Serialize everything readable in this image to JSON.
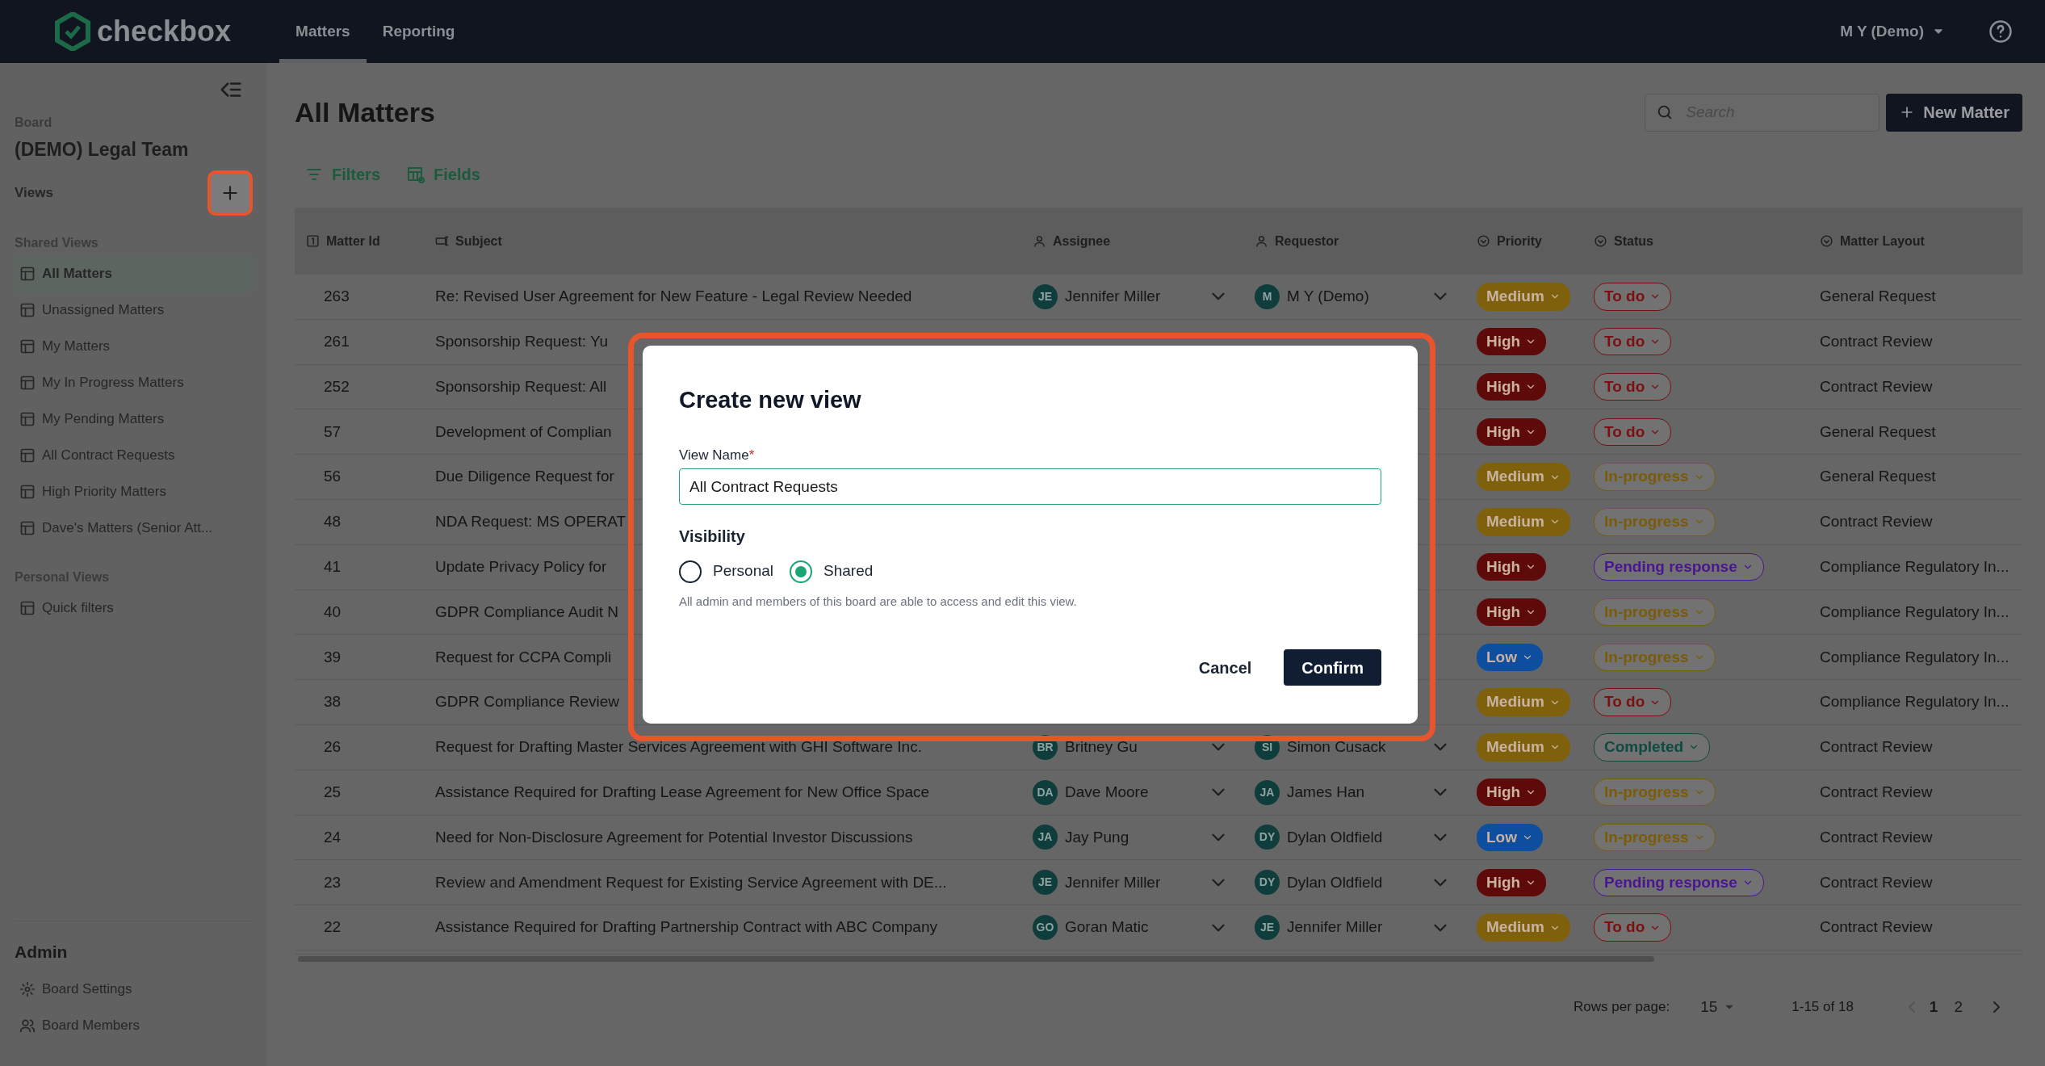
{
  "navbar": {
    "logo": "checkbox",
    "tabs": [
      {
        "label": "Matters",
        "selected": true
      },
      {
        "label": "Reporting",
        "selected": false
      }
    ],
    "user": "M Y (Demo)"
  },
  "sidebar": {
    "board_label": "Board",
    "board_name": "(DEMO) Legal Team",
    "views_label": "Views",
    "sections": [
      {
        "title": "Shared Views",
        "items": [
          {
            "label": "All Matters",
            "selected": true
          },
          {
            "label": "Unassigned Matters",
            "selected": false
          },
          {
            "label": "My Matters",
            "selected": false
          },
          {
            "label": "My In Progress Matters",
            "selected": false
          },
          {
            "label": "My Pending Matters",
            "selected": false
          },
          {
            "label": "All Contract Requests",
            "selected": false
          },
          {
            "label": "High Priority Matters",
            "selected": false
          },
          {
            "label": "Dave's Matters (Senior Att...",
            "selected": false
          }
        ]
      },
      {
        "title": "Personal Views",
        "items": [
          {
            "label": "Quick filters",
            "selected": false
          }
        ]
      }
    ],
    "admin": {
      "title": "Admin",
      "items": [
        {
          "label": "Board Settings",
          "kind": "settings"
        },
        {
          "label": "Board Members",
          "kind": "members"
        }
      ]
    }
  },
  "page": {
    "title": "All Matters",
    "search": {
      "placeholder": "Search"
    },
    "new_button": "New Matter",
    "toolbar": [
      {
        "label": "Filters",
        "kind": "filter"
      },
      {
        "label": "Fields",
        "kind": "fields"
      }
    ]
  },
  "table": {
    "columns": [
      {
        "label": "Matter Id",
        "kind": "number"
      },
      {
        "label": "Subject",
        "kind": "text"
      },
      {
        "label": "Assignee",
        "kind": "person"
      },
      {
        "label": "Requestor",
        "kind": "person"
      },
      {
        "label": "Priority",
        "kind": "select"
      },
      {
        "label": "Status",
        "kind": "select"
      },
      {
        "label": "Matter Layout",
        "kind": "select"
      }
    ],
    "rows": [
      {
        "id": "263",
        "subject": "Re: Revised User Agreement for New Feature - Legal Review Needed",
        "assignee": {
          "initials": "JE",
          "name": "Jennifer Miller"
        },
        "requestor": {
          "initials": "M",
          "name": "M Y (Demo)"
        },
        "priority": {
          "label": "Medium",
          "color": "#7f600c"
        },
        "status": {
          "label": "To do",
          "color": "#7a1010"
        },
        "layout": "General Request"
      },
      {
        "id": "261",
        "subject": "Sponsorship Request: Yu",
        "priority": {
          "label": "High",
          "color": "#5e0a0a"
        },
        "status": {
          "label": "To do",
          "color": "#7a1010"
        },
        "layout": "Contract Review"
      },
      {
        "id": "252",
        "subject": "Sponsorship Request: All",
        "priority": {
          "label": "High",
          "color": "#5e0a0a"
        },
        "status": {
          "label": "To do",
          "color": "#7a1010"
        },
        "layout": "Contract Review"
      },
      {
        "id": "57",
        "subject": "Development of Complian",
        "priority": {
          "label": "High",
          "color": "#5e0a0a"
        },
        "status": {
          "label": "To do",
          "color": "#7a1010"
        },
        "layout": "General Request"
      },
      {
        "id": "56",
        "subject": "Due Diligence Request for",
        "priority": {
          "label": "Medium",
          "color": "#7f600c"
        },
        "status": {
          "label": "In-progress",
          "color": "#7a5c08"
        },
        "layout": "General Request"
      },
      {
        "id": "48",
        "subject": "NDA Request: MS OPERAT",
        "priority": {
          "label": "Medium",
          "color": "#7f600c"
        },
        "status": {
          "label": "In-progress",
          "color": "#7a5c08"
        },
        "layout": "Contract Review"
      },
      {
        "id": "41",
        "subject": "Update Privacy Policy for",
        "priority": {
          "label": "High",
          "color": "#5e0a0a"
        },
        "status": {
          "label": "Pending response",
          "color": "#4a1590"
        },
        "layout": "Compliance Regulatory In..."
      },
      {
        "id": "40",
        "subject": "GDPR Compliance Audit N",
        "priority": {
          "label": "High",
          "color": "#5e0a0a"
        },
        "status": {
          "label": "In-progress",
          "color": "#7a5c08"
        },
        "layout": "Compliance Regulatory In..."
      },
      {
        "id": "39",
        "subject": "Request for CCPA Compli",
        "priority": {
          "label": "Low",
          "color": "#0d4e9e"
        },
        "status": {
          "label": "In-progress",
          "color": "#7a5c08"
        },
        "layout": "Compliance Regulatory In..."
      },
      {
        "id": "38",
        "subject": "GDPR Compliance Review",
        "priority": {
          "label": "Medium",
          "color": "#7f600c"
        },
        "status": {
          "label": "To do",
          "color": "#7a1010"
        },
        "layout": "Compliance Regulatory In..."
      },
      {
        "id": "26",
        "subject": "Request for Drafting Master Services Agreement with GHI Software Inc.",
        "assignee": {
          "initials": "BR",
          "name": "Britney Gu"
        },
        "requestor": {
          "initials": "SI",
          "name": "Simon Cusack"
        },
        "priority": {
          "label": "Medium",
          "color": "#7f600c"
        },
        "status": {
          "label": "Completed",
          "color": "#0f4a40"
        },
        "layout": "Contract Review"
      },
      {
        "id": "25",
        "subject": "Assistance Required for Drafting Lease Agreement for New Office Space",
        "assignee": {
          "initials": "DA",
          "name": "Dave Moore"
        },
        "requestor": {
          "initials": "JA",
          "name": "James Han"
        },
        "priority": {
          "label": "High",
          "color": "#5e0a0a"
        },
        "status": {
          "label": "In-progress",
          "color": "#7a5c08"
        },
        "layout": "Contract Review"
      },
      {
        "id": "24",
        "subject": "Need for Non-Disclosure Agreement for Potential Investor Discussions",
        "assignee": {
          "initials": "JA",
          "name": "Jay Pung"
        },
        "requestor": {
          "initials": "DY",
          "name": "Dylan Oldfield"
        },
        "priority": {
          "label": "Low",
          "color": "#0d4e9e"
        },
        "status": {
          "label": "In-progress",
          "color": "#7a5c08"
        },
        "layout": "Contract Review"
      },
      {
        "id": "23",
        "subject": "Review and Amendment Request for Existing Service Agreement with DE...",
        "assignee": {
          "initials": "JE",
          "name": "Jennifer Miller"
        },
        "requestor": {
          "initials": "DY",
          "name": "Dylan Oldfield"
        },
        "priority": {
          "label": "High",
          "color": "#5e0a0a"
        },
        "status": {
          "label": "Pending response",
          "color": "#4a1590"
        },
        "layout": "Contract Review"
      },
      {
        "id": "22",
        "subject": "Assistance Required for Drafting Partnership Contract with ABC Company",
        "assignee": {
          "initials": "GO",
          "name": "Goran Matic"
        },
        "requestor": {
          "initials": "JE",
          "name": "Jennifer Miller"
        },
        "priority": {
          "label": "Medium",
          "color": "#7f600c"
        },
        "status": {
          "label": "To do",
          "color": "#7a1010"
        },
        "layout": "Contract Review"
      }
    ]
  },
  "pagination": {
    "rows_per_page_label": "Rows per page:",
    "rows_per_page": "15",
    "range": "1-15 of 18",
    "pages": [
      {
        "label": "1",
        "selected": true
      },
      {
        "label": "2",
        "selected": false
      }
    ]
  },
  "modal": {
    "title": "Create new view",
    "field_label": "View Name",
    "required_mark": "*",
    "value": "All Contract Requests",
    "visibility_label": "Visibility",
    "options": [
      {
        "label": "Personal",
        "selected": false
      },
      {
        "label": "Shared",
        "selected": true
      }
    ],
    "hint": "All admin and members of this board are able to access and edit this view.",
    "buttons": [
      {
        "label": "Cancel",
        "kind": "secondary"
      },
      {
        "label": "Confirm",
        "kind": "primary"
      }
    ]
  }
}
